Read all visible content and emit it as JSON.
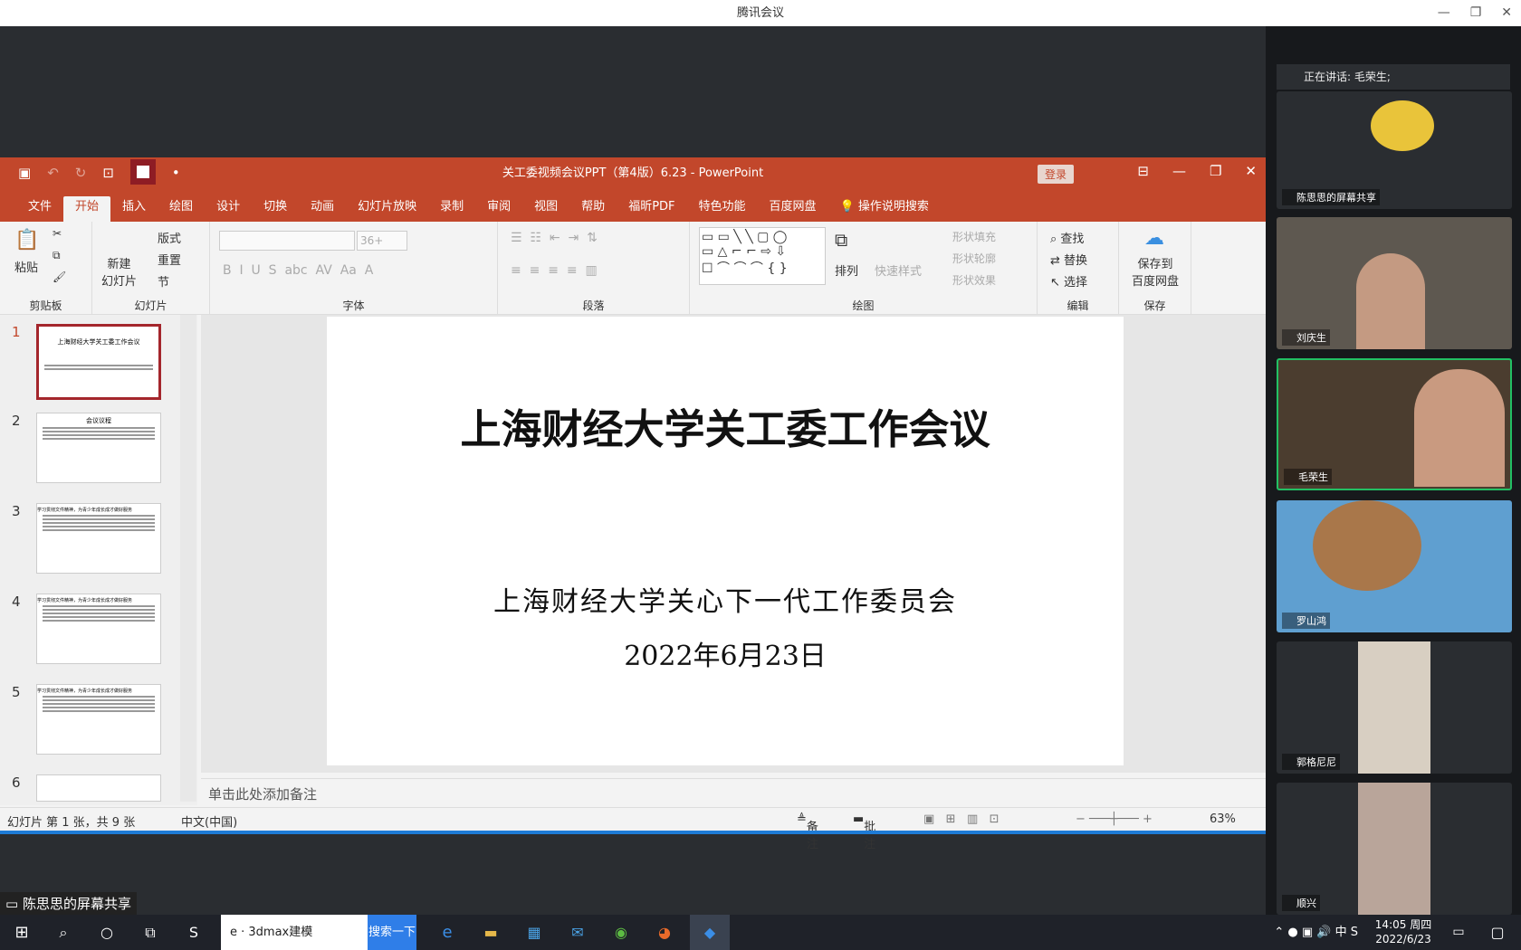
{
  "app": {
    "title": "腾讯会议",
    "min": "—",
    "max": "❐",
    "close": "✕"
  },
  "ppt": {
    "filename": "关工委视频会议PPT（第4版）6.23  -  PowerPoint",
    "login": "登录",
    "tabs": [
      "文件",
      "开始",
      "插入",
      "绘图",
      "设计",
      "切换",
      "动画",
      "幻灯片放映",
      "录制",
      "审阅",
      "视图",
      "帮助",
      "福昕PDF",
      "特色功能",
      "百度网盘",
      "操作说明搜索"
    ],
    "ribbon": {
      "clipboard": "剪贴板",
      "paste": "粘贴",
      "slides": "幻灯片",
      "new_slide": "新建\n幻灯片",
      "layout": "版式",
      "reset": "重置",
      "section": "节",
      "font": "字体",
      "font_size": "36+",
      "paragraph": "段落",
      "drawing": "绘图",
      "arrange": "排列",
      "quick_styles": "快速样式",
      "shape_fill": "形状填充",
      "shape_outline": "形状轮廓",
      "shape_effects": "形状效果",
      "editing": "编辑",
      "find": "查找",
      "replace": "替换",
      "select": "选择",
      "save": "保存",
      "save_baidu": "保存到\n百度网盘"
    },
    "thumbs": [
      {
        "n": "1",
        "title": "上海财经大学关工委工作会议"
      },
      {
        "n": "2",
        "title": "会议议程"
      },
      {
        "n": "3",
        "title": "学习贯彻文件精神，为青少年成长成才做好服务"
      },
      {
        "n": "4",
        "title": "学习贯彻文件精神，为青少年成长成才做好服务"
      },
      {
        "n": "5",
        "title": "学习贯彻文件精神，为青少年成长成才做好服务"
      },
      {
        "n": "6",
        "title": ""
      }
    ],
    "slide": {
      "title": "上海财经大学关工委工作会议",
      "org": "上海财经大学关心下一代工作委员会",
      "date": "2022年6月23日"
    },
    "notes": "单击此处添加备注",
    "status": {
      "slide_info": "幻灯片 第 1 张，共 9 张",
      "lang": "中文(中国)",
      "notes_btn": "备注",
      "comments_btn": "批注",
      "zoom": "63%"
    }
  },
  "share_label": "陈思思的屏幕共享",
  "meeting": {
    "speaking": "正在讲话: 毛荣生;",
    "participants": [
      {
        "name": "陈思思的屏幕共享",
        "color": "#c99a2e"
      },
      {
        "name": "刘庆生",
        "color": "#6a6258"
      },
      {
        "name": "毛荣生",
        "color": "#5a4a3a"
      },
      {
        "name": "罗山鸿",
        "color": "#5f9fd0"
      },
      {
        "name": "郭格尼尼",
        "color": "#2a2d31"
      },
      {
        "name": "顺兴",
        "color": "#2a2d31"
      }
    ]
  },
  "taskbar": {
    "app1": "3dmax建模",
    "search": "搜索一下",
    "time": "14:05 周四",
    "date": "2022/6/23",
    "ime": "中"
  }
}
